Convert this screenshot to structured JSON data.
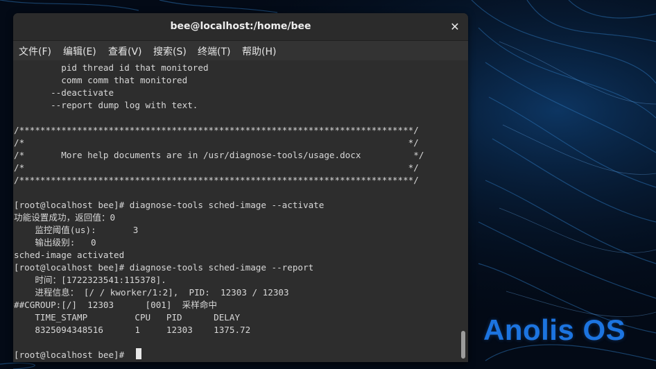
{
  "window": {
    "title": "bee@localhost:/home/bee",
    "close_glyph": "✕"
  },
  "menu": [
    "文件(F)",
    "编辑(E)",
    "查看(V)",
    "搜索(S)",
    "终端(T)",
    "帮助(H)"
  ],
  "terminal": {
    "lines": [
      "         pid thread id that monitored",
      "         comm comm that monitored",
      "       --deactivate",
      "       --report dump log with text.",
      "",
      "/***************************************************************************/",
      "/*                                                                         */",
      "/*       More help documents are in /usr/diagnose-tools/usage.docx          */",
      "/*                                                                         */",
      "/***************************************************************************/",
      "",
      "[root@localhost bee]# diagnose-tools sched-image --activate",
      "功能设置成功，返回值：0",
      "    监控阈值(us):       3",
      "    输出级别:   0",
      "sched-image activated",
      "[root@localhost bee]# diagnose-tools sched-image --report",
      "    时间：[1722323541:115378].",
      "    进程信息： [/ / kworker/1:2],  PID:  12303 / 12303",
      "##CGROUP:[/]  12303      [001]  采样命中",
      "    TIME_STAMP         CPU   PID      DELAY",
      "    8325094348516      1     12303    1375.72",
      "",
      "[root@localhost bee]# "
    ]
  },
  "desktop": {
    "brand": "Anolis OS",
    "brand_color": "#1c74e0",
    "background_color": "#030a16"
  }
}
